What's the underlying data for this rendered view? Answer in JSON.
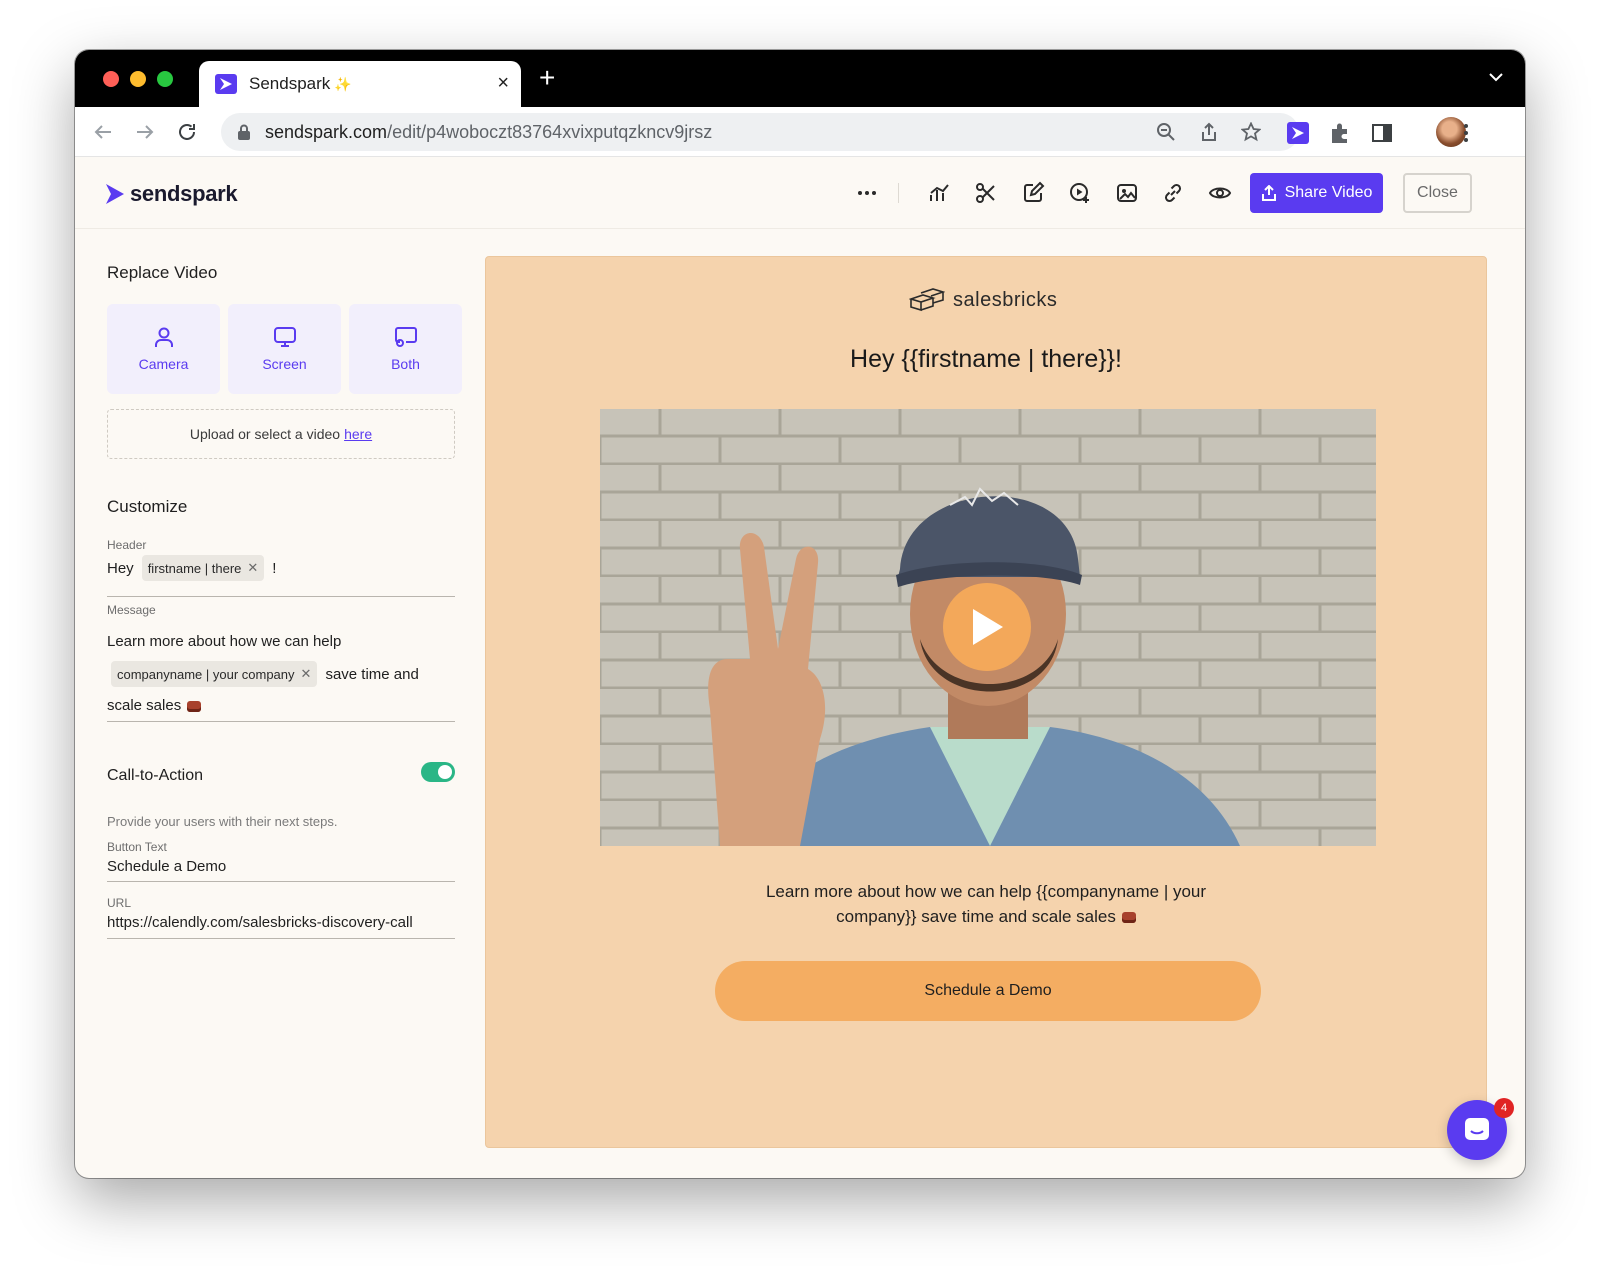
{
  "browser": {
    "tab_title": "Sendspark",
    "tab_sparkle": "✨",
    "url_host": "sendspark.com",
    "url_path": "/edit/p4woboczt83764xvixputqzkncv9jrsz"
  },
  "header": {
    "brand": "sendspark",
    "share_label": "Share Video",
    "close_label": "Close",
    "icons": [
      "more-icon",
      "analytics-icon",
      "scissors-icon",
      "edit-icon",
      "video-add-icon",
      "thumbnail-icon",
      "link-icon",
      "preview-eye-icon"
    ],
    "accent": "#5a3bf0"
  },
  "panel": {
    "replace_title": "Replace Video",
    "options": [
      {
        "label": "Camera",
        "icon": "person-icon"
      },
      {
        "label": "Screen",
        "icon": "monitor-icon"
      },
      {
        "label": "Both",
        "icon": "screen-camera-icon"
      }
    ],
    "upload_text": "Upload or select a video",
    "upload_link": "here",
    "customize_title": "Customize",
    "header_label": "Header",
    "header_prefix": "Hey",
    "header_chip": "firstname | there",
    "header_suffix": "!",
    "message_label": "Message",
    "message_line1": "Learn more about how we can help",
    "message_chip": "companyname | your company",
    "message_after_chip": "save time and",
    "message_line3": "scale sales",
    "cta_title": "Call-to-Action",
    "cta_enabled": true,
    "cta_help": "Provide your users with their next steps.",
    "button_text_label": "Button Text",
    "button_text_value": "Schedule a Demo",
    "url_label": "URL",
    "url_value": "https://calendly.com/salesbricks-discovery-call"
  },
  "preview": {
    "logo_text": "salesbricks",
    "headline": "Hey {{firstname | there}}!",
    "message": "Learn more about how we can help {{companyname | your company}} save time and scale sales",
    "cta_label": "Schedule a Demo",
    "background": "#f5d3ad",
    "cta_color": "#f4ad62"
  },
  "chat": {
    "badge_count": "4"
  }
}
